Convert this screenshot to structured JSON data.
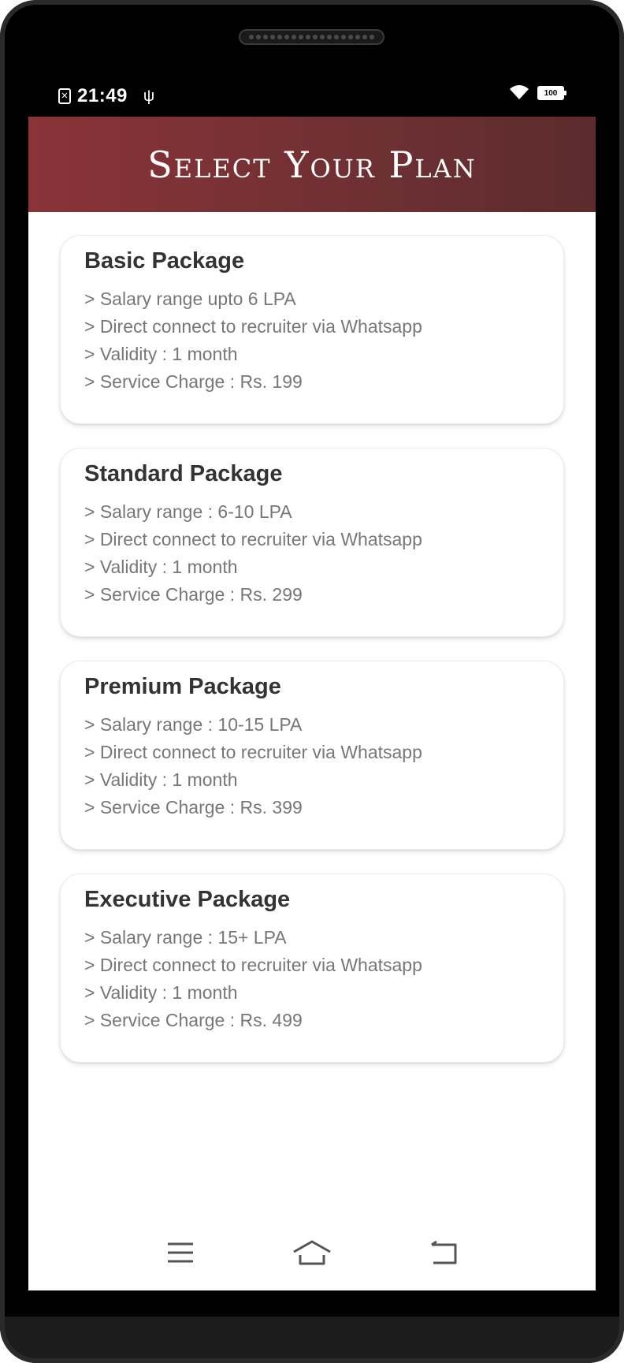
{
  "status_bar": {
    "time": "21:49",
    "battery": "100",
    "icons": [
      "sim-card-icon",
      "usb-icon",
      "wifi-icon",
      "battery-icon"
    ]
  },
  "header": {
    "title": "Select Your Plan",
    "gradient_start": "#8a3338",
    "gradient_end": "#5c2b2d"
  },
  "plans": [
    {
      "title": "Basic Package",
      "lines": [
        "> Salary range upto 6 LPA",
        "> Direct connect to recruiter via Whatsapp",
        "> Validity : 1 month",
        "> Service Charge : Rs. 199"
      ]
    },
    {
      "title": "Standard Package",
      "lines": [
        "> Salary range : 6-10 LPA",
        "> Direct connect to recruiter via Whatsapp",
        "> Validity : 1 month",
        "> Service Charge : Rs. 299"
      ]
    },
    {
      "title": "Premium Package",
      "lines": [
        "> Salary range : 10-15 LPA",
        "> Direct connect to recruiter via Whatsapp",
        "> Validity : 1 month",
        "> Service Charge : Rs. 399"
      ]
    },
    {
      "title": "Executive Package",
      "lines": [
        "> Salary range : 15+ LPA",
        "> Direct connect to recruiter via Whatsapp",
        "> Validity : 1 month",
        "> Service Charge : Rs. 499"
      ]
    }
  ],
  "nav": {
    "icons": [
      "menu-icon",
      "home-icon",
      "back-icon"
    ]
  }
}
